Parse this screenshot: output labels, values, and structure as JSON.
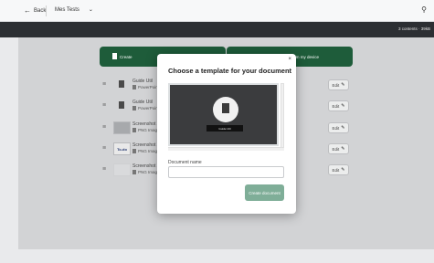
{
  "header": {
    "back_label": "Back",
    "doc_title": "Mes Tests",
    "content_count": "3 contents · 39kB"
  },
  "actions": {
    "create_label": "Create",
    "device_label": "om my device"
  },
  "rows": [
    {
      "name": "Guide Util",
      "type": "PowerPoint",
      "edit": "Edit"
    },
    {
      "name": "Guide Util",
      "type": "PowerPoint",
      "edit": "Edit"
    },
    {
      "name": "Screenshot 2",
      "type": "PNG Image",
      "edit": "Edit"
    },
    {
      "name": "Screenshot 2",
      "type": "PNG Image",
      "edit": "Edit"
    },
    {
      "name": "Screenshot 2",
      "type": "PNG Image",
      "edit": "Edit"
    }
  ],
  "thumb_text": "To-do",
  "modal": {
    "close": "×",
    "title": "Choose a template for your document",
    "preview_caption": "Guide Util",
    "field_label": "Document name",
    "field_value": "",
    "field_placeholder": "",
    "create_button": "Create document"
  },
  "icons": {
    "back": "arrow-left-icon",
    "search": "search-icon",
    "pen": "pencil-icon"
  }
}
